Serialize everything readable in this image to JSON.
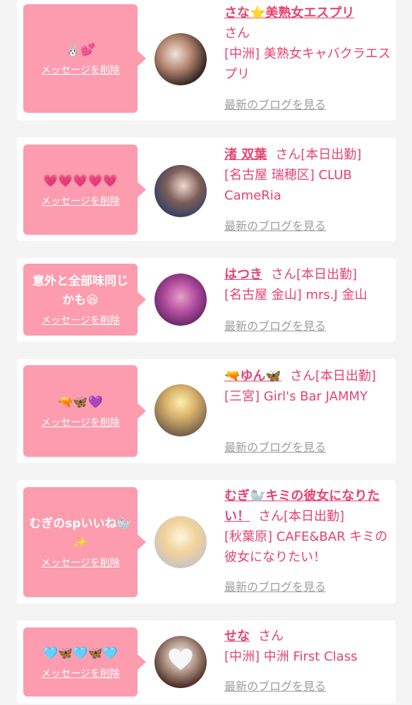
{
  "common": {
    "delete_label": "メッセージを削除",
    "blog_label": "最新のブログを見る",
    "san": "さん"
  },
  "cards": [
    {
      "message": "🐰💕",
      "name": "さな⭐美熟女エスプリ",
      "suffix": "さん",
      "shop": "[中洲] 美熟女キャバクラエスプリ"
    },
    {
      "message": "💗💗💗💗💗",
      "name": "渚 双葉",
      "suffix": "さん[本日出勤]",
      "shop": "[名古屋 瑞穂区] CLUB CameRia"
    },
    {
      "message": "意外と全部味同じかも😆",
      "name": "はつき",
      "suffix": "さん[本日出勤]",
      "shop": "[名古屋 金山] mrs.J 金山"
    },
    {
      "message": "🔫🦋💜",
      "name": "🔫ゆん🦋",
      "suffix": "さん[本日出勤]",
      "shop": "[三宮] Girl's Bar JAMMY"
    },
    {
      "message": "むぎのspいいね🦭✨",
      "name": "むぎ🦭キミの彼女になりたい！",
      "suffix": "さん[本日出勤]",
      "shop": "[秋葉原] CAFE&BAR キミの彼女になりたい！"
    },
    {
      "message": "🩵🦋🩵🦋🩵",
      "name": "せな",
      "suffix": "さん",
      "shop": "[中洲] 中洲 First Class"
    }
  ],
  "colors": {
    "bubble": "#fc9cae",
    "accent": "#e8426f",
    "muted": "#9c9c9c",
    "background": "#f4f4f4"
  }
}
